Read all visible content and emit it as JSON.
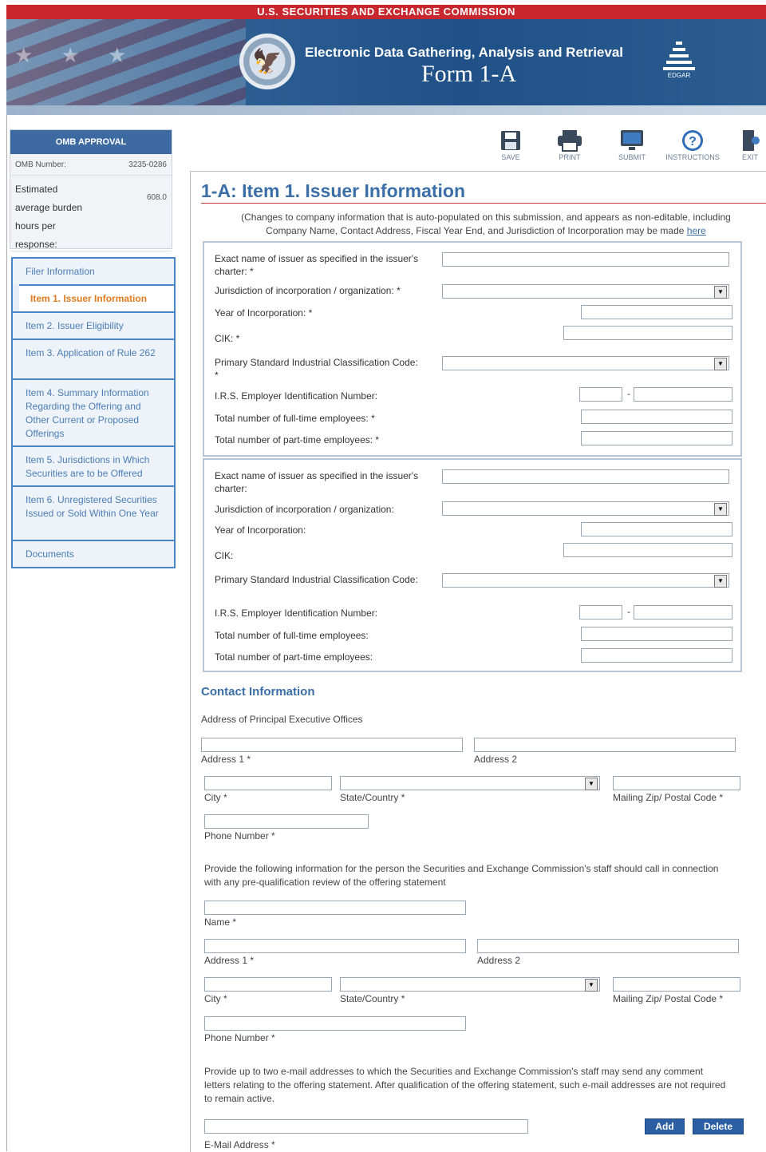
{
  "header": {
    "agency": "U.S. SECURITIES AND EXCHANGE COMMISSION",
    "subtitle": "Electronic Data Gathering, Analysis and Retrieval",
    "form_title": "Form 1-A",
    "logo_text": "EDGAR"
  },
  "omb": {
    "title": "OMB APPROVAL",
    "number_label": "OMB Number:",
    "number_value": "3235-0286",
    "burden_label": "Estimated average burden hours per response:",
    "burden_value": "608.0"
  },
  "nav": {
    "items": [
      {
        "label": "Filer Information"
      },
      {
        "label": "Item 1. Issuer Information"
      },
      {
        "label": "Item 2. Issuer Eligibility"
      },
      {
        "label": "Item 3. Application of Rule 262"
      },
      {
        "label": "Item 4. Summary Information Regarding the Offering and Other Current or Proposed Offerings"
      },
      {
        "label": "Item 5. Jurisdictions in Which Securities are to be Offered"
      },
      {
        "label": "Item 6. Unregistered Securities Issued or Sold Within One Year"
      },
      {
        "label": "Documents"
      }
    ]
  },
  "toolbar": {
    "save": "SAVE",
    "print": "PRINT",
    "submit": "SUBMIT",
    "instructions": "INSTRUCTIONS",
    "exit": "EXIT"
  },
  "page": {
    "title": "1-A: Item 1. Issuer Information",
    "note_line1": "(Changes to company information that is auto-populated on this submission, and appears as non-editable, including",
    "note_line2": "Company Name, Contact Address, Fiscal Year End, and Jurisdiction of Incorporation may be made",
    "note_link": "here"
  },
  "issuer_box1": {
    "exact_name": "Exact name of issuer as specified in the issuer's charter: *",
    "jurisdiction": "Jurisdiction of incorporation / organization: *",
    "year": "Year of Incorporation: *",
    "cik": "CIK: *",
    "sic": "Primary Standard Industrial Classification Code: *",
    "irs": "I.R.S. Employer Identification Number:",
    "fulltime": "Total number of full-time employees: *",
    "parttime": "Total number of part-time employees: *"
  },
  "issuer_box2": {
    "exact_name": "Exact name of issuer as specified in the issuer's charter:",
    "jurisdiction": "Jurisdiction of incorporation / organization:",
    "year": "Year of Incorporation:",
    "cik": "CIK:",
    "sic": "Primary Standard Industrial Classification Code:",
    "irs": "I.R.S. Employer Identification Number:",
    "fulltime": "Total number of full-time employees:",
    "parttime": "Total number of part-time employees:"
  },
  "contact": {
    "title": "Contact Information",
    "address_heading": "Address of Principal Executive Offices",
    "address1": "Address 1 *",
    "address2": "Address 2",
    "city": "City *",
    "state": "State/Country *",
    "zip": "Mailing Zip/ Postal Code *",
    "phone": "Phone Number *",
    "staff_text": "Provide the following information for the person the Securities and Exchange Commission's staff should call in connection with any pre-qualification review of the offering statement",
    "name": "Name *",
    "address1_b": "Address 1 *",
    "address2_b": "Address 2",
    "city_b": "City *",
    "state_b": "State/Country *",
    "zip_b": "Mailing Zip/ Postal Code *",
    "phone_b": "Phone Number *",
    "email_text": "Provide up to two e-mail addresses to which the Securities and Exchange Commission's staff may send any comment letters relating to the offering statement. After qualification of the offering statement, such e-mail addresses are not required to remain active.",
    "add": "Add",
    "delete": "Delete",
    "email_label": "E-Mail Address *"
  }
}
